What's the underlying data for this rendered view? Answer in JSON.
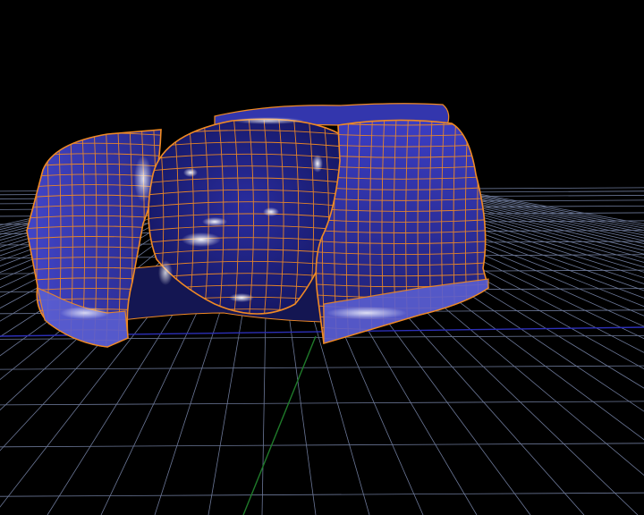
{
  "viewport": {
    "background_color": "#000000",
    "grid_color": "#7f8db3",
    "x_axis_color": "#2c2fb8",
    "z_axis_color": "#1f7a2a",
    "model_surface_color": "#2c2f9a",
    "model_wireframe_color": "#f08a24",
    "model_highlight_color": "#ffffff"
  }
}
